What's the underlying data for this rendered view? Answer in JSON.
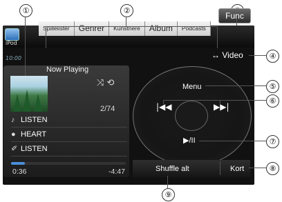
{
  "callouts": [
    "①",
    "②",
    "③",
    "④",
    "⑤",
    "⑥",
    "⑦",
    "⑧",
    "⑨"
  ],
  "app": {
    "name": "iPod",
    "time": "10:00"
  },
  "tabs": [
    "Spillelister",
    "Genrer",
    "Kunstnere",
    "Album",
    "Podcasts"
  ],
  "func_label": "Func",
  "video_label": "↔ Video",
  "now_playing": {
    "title": "Now Playing",
    "counter": "2/74",
    "song": "LISTEN",
    "artist": "HEART",
    "album": "LISTEN",
    "elapsed": "0:36",
    "remaining": "-4:47",
    "progress": 0.12,
    "shuffle_icon": "shuffle-repeat-icons"
  },
  "wheel": {
    "menu": "Menu",
    "prev": "|◀◀",
    "next": "▶▶|",
    "play": "▶/II"
  },
  "shuffle_label": "Shuffle alt",
  "kort_label": "Kort",
  "colors": {
    "accent": "#4a8fd8"
  }
}
